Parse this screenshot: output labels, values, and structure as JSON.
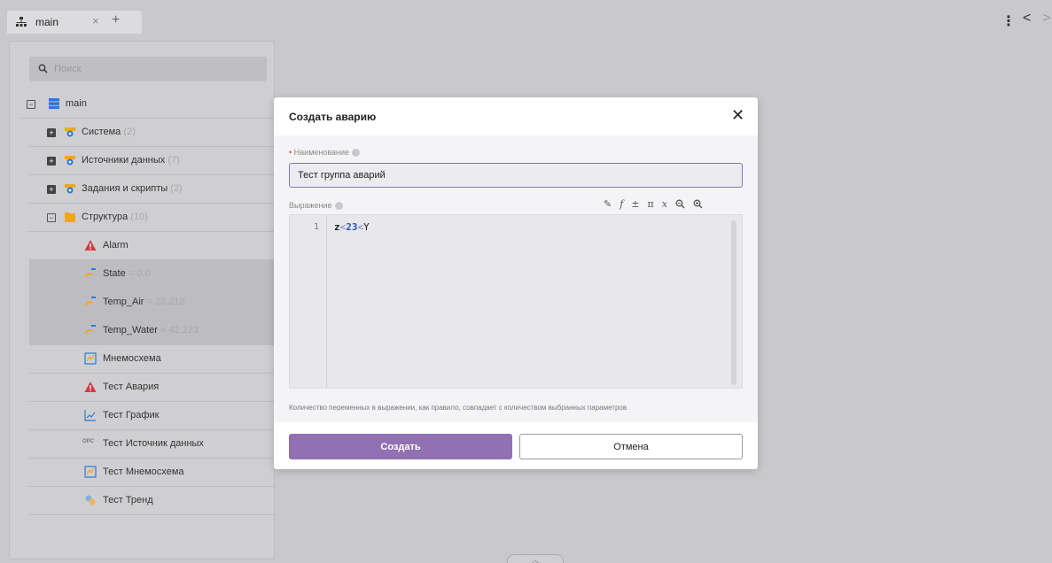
{
  "tab": {
    "title": "main",
    "close": "×",
    "add": "+"
  },
  "topbar": {
    "menu": "⋮",
    "back": "<",
    "forward": ">"
  },
  "search": {
    "placeholder": "Поиск"
  },
  "tree": {
    "root": {
      "label": "main"
    },
    "items": [
      {
        "label": "Система",
        "count": "(2)"
      },
      {
        "label": "Источники данных",
        "count": "(7)"
      },
      {
        "label": "Задания и скрипты",
        "count": "(2)"
      },
      {
        "label": "Структура",
        "count": "(10)"
      }
    ],
    "children": [
      {
        "label": "Alarm",
        "value": ""
      },
      {
        "label": "State",
        "value": "= 0,0"
      },
      {
        "label": "Temp_Air",
        "value": "= 23,218"
      },
      {
        "label": "Temp_Water",
        "value": "= 42,273"
      },
      {
        "label": "Мнемосхема",
        "value": ""
      },
      {
        "label": "Тест Авария",
        "value": ""
      },
      {
        "label": "Тест График",
        "value": ""
      },
      {
        "label": "Тест Источник данных",
        "value": "",
        "badge": "OPC"
      },
      {
        "label": "Тест Мнемосхема",
        "value": ""
      },
      {
        "label": "Тест Тренд",
        "value": ""
      }
    ]
  },
  "dialog": {
    "title": "Создать аварию",
    "close": "✕",
    "name_label": "Наименование",
    "name_required_mark": "•",
    "name_value": "Тест группа аварий",
    "expression_label": "Выражение",
    "tools": [
      "✎",
      "f",
      "±",
      "π",
      "x"
    ],
    "line_number": "1",
    "code": {
      "a": "z",
      "op1": "<",
      "num": "23",
      "op2": "<",
      "b": "Y"
    },
    "hint": "Количество переменных в выражении, как правило, совпадает с количеством выбранных параметров",
    "create_label": "Создать",
    "cancel_label": "Отмена"
  },
  "colors": {
    "accent": "#9271b3",
    "alarm": "#d9363e",
    "folder": "#f0a623"
  }
}
